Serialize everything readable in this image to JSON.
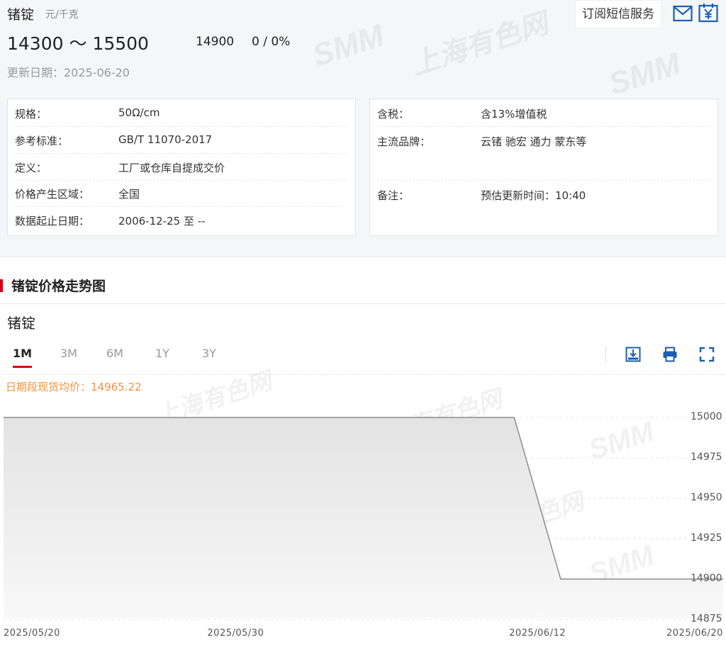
{
  "product": {
    "name": "锗锭",
    "unit": "元/千克",
    "price_range": "14300 ～ 15500",
    "average": "14900",
    "change": "0 / 0%",
    "update_date": "更新日期：2025-06-20",
    "subscribe_label": "订阅短信服务"
  },
  "watermark": {
    "brand": "SMM",
    "name": "上海有色网"
  },
  "specs_left": [
    {
      "key": "规格：",
      "value": "50Ω/cm"
    },
    {
      "key": "参考标准：",
      "value": "GB/T 11070-2017"
    },
    {
      "key": "定义：",
      "value": "工厂或仓库自提成交价"
    },
    {
      "key": "价格产生区域：",
      "value": "全国"
    },
    {
      "key": "数据起止日期：",
      "value": "2006-12-25 至 --"
    }
  ],
  "specs_right": [
    {
      "key": "含税：",
      "value": "含13%增值税"
    },
    {
      "key": "主流品牌：",
      "value": "云锗 驰宏 通力 蒙东等"
    },
    {
      "key": "备注：",
      "value": "预估更新时间：10:40"
    }
  ],
  "section_title": "锗锭价格走势图",
  "chart_title": "锗锭",
  "tabs": [
    "1M",
    "3M",
    "6M",
    "1Y",
    "3Y"
  ],
  "active_tab": "1M",
  "period_average": "日期段现货均价：14965.22",
  "icons": [
    "mail-icon",
    "yuan-calendar-icon",
    "download-image-icon",
    "print-icon",
    "fullscreen-icon"
  ],
  "colors": {
    "accent": "#d7000f",
    "icon_blue": "#1b5fb4",
    "average_text": "#f5923e"
  },
  "chart_data": {
    "type": "area",
    "x": [
      "2025/05/20",
      "2025/06/11",
      "2025/06/13",
      "2025/06/20"
    ],
    "values": [
      15000,
      15000,
      14900,
      14900
    ],
    "y_ticks": [
      15000,
      14975,
      14950,
      14925,
      14900,
      14875
    ],
    "x_tick_labels": [
      "2025/05/20",
      "2025/05/30",
      "2025/06/12",
      "2025/06/20"
    ],
    "ylim": [
      14875,
      15005
    ],
    "xlim": [
      "2025/05/20",
      "2025/06/20"
    ],
    "grid": true,
    "legend": "none"
  }
}
